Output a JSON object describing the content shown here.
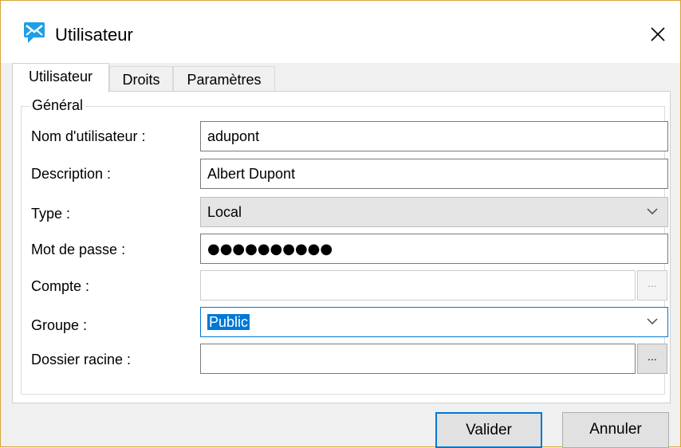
{
  "window": {
    "title": "Utilisateur"
  },
  "tabs": [
    {
      "label": "Utilisateur",
      "active": true
    },
    {
      "label": "Droits",
      "active": false
    },
    {
      "label": "Paramètres",
      "active": false
    }
  ],
  "group": {
    "legend": "Général"
  },
  "form": {
    "username": {
      "label": "Nom d'utilisateur :",
      "value": "adupont"
    },
    "description": {
      "label": "Description :",
      "value": "Albert Dupont"
    },
    "type": {
      "label": "Type :",
      "value": "Local"
    },
    "password": {
      "label": "Mot de passe :",
      "value": "●●●●●●●●●●"
    },
    "account": {
      "label": "Compte :",
      "value": "",
      "button": "..."
    },
    "group": {
      "label": "Groupe :",
      "value": "Public"
    },
    "root_folder": {
      "label": "Dossier racine :",
      "value": "",
      "button": "..."
    }
  },
  "buttons": {
    "ok": "Valider",
    "cancel": "Annuler"
  },
  "icons": {
    "app": "message-icon",
    "close": "close-icon",
    "dropdown": "chevron-down-icon"
  },
  "colors": {
    "accent": "#0078d7",
    "app_icon": "#1e9fe6",
    "window_border": "#d8a33a"
  }
}
